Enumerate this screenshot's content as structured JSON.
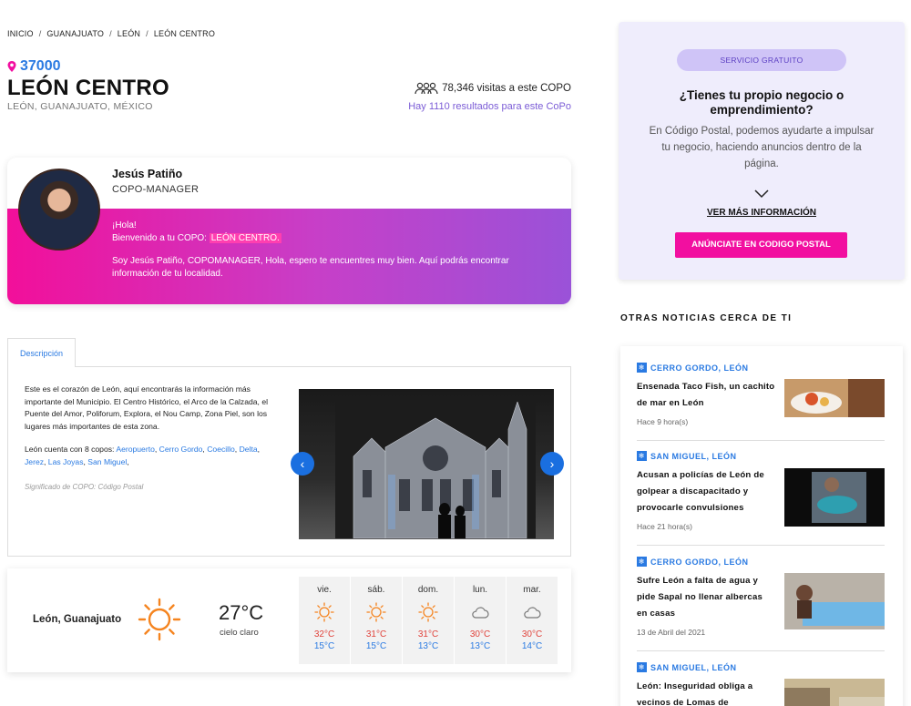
{
  "breadcrumb": {
    "items": [
      "INICIO",
      "GUANAJUATO",
      "LEÓN",
      "LEÓN CENTRO"
    ],
    "separator": "/"
  },
  "place": {
    "zip": "37000",
    "name": "LEÓN CENTRO",
    "subtitle": "LEÓN, GUANAJUATO, MÉXICO",
    "visits": "78,346 visitas a este COPO",
    "results": "Hay 1110 resultados para este CoPo"
  },
  "manager": {
    "name": "Jesús Patiño",
    "role": "COPO-MANAGER",
    "greeting": "¡Hola!",
    "welcome_prefix": "Bienvenido a tu COPO: ",
    "welcome_place": "LEÓN CENTRO.",
    "message": "Soy Jesús Patiño, COPOMANAGER, Hola, espero te encuentres muy bien. Aquí podrás encontrar información de tu localidad."
  },
  "description": {
    "tab_label": "Descripción",
    "paragraph1": "Este es el corazón de León, aquí encontrarás la información más importante del Municipio. El Centro Histórico, el Arco de la Calzada, el Puente del Amor, Poliforum, Explora, el Nou Camp, Zona Piel, son los lugares más importantes de esta zona.",
    "copos_prefix": "León cuenta con 8 copos: ",
    "copos": [
      "Aeropuerto",
      "Cerro Gordo",
      "Coecillo",
      "Delta",
      "Jerez",
      "Las Joyas",
      "San Miguel"
    ],
    "note": "Significado de COPO: Código Postal",
    "prev_arrow": "‹",
    "next_arrow": "›"
  },
  "weather": {
    "city": "León, Guanajuato",
    "current_temp": "27°C",
    "condition": "cielo claro",
    "sun_color": "#f5841f",
    "days": [
      {
        "name": "vie.",
        "icon": "sun-icon",
        "high": "32°C",
        "low": "15°C"
      },
      {
        "name": "sáb.",
        "icon": "sun-icon",
        "high": "31°C",
        "low": "15°C"
      },
      {
        "name": "dom.",
        "icon": "sun-icon",
        "high": "31°C",
        "low": "13°C"
      },
      {
        "name": "lun.",
        "icon": "cloud-icon",
        "high": "30°C",
        "low": "13°C"
      },
      {
        "name": "mar.",
        "icon": "cloud-icon",
        "high": "30°C",
        "low": "14°C"
      }
    ]
  },
  "promo": {
    "badge": "SERVICIO GRATUITO",
    "title": "¿Tienes tu propio negocio o emprendimiento?",
    "text": "En Código Postal, podemos ayudarte a impulsar tu negocio, haciendo anuncios dentro de la página.",
    "more_link": "VER MÁS INFORMACIÓN",
    "cta": "ANÚNCIATE EN CODIGO POSTAL"
  },
  "news": {
    "heading": "OTRAS NOTICIAS CERCA DE TI",
    "items": [
      {
        "tag": "CERRO GORDO, LEÓN",
        "title": "Ensenada Taco Fish, un cachito de mar en León",
        "time": "Hace 9 hora(s)"
      },
      {
        "tag": "SAN MIGUEL, LEÓN",
        "title": "Acusan a policías de León de golpear a discapacitado y provocarle convulsiones",
        "time": "Hace 21 hora(s)"
      },
      {
        "tag": "CERRO GORDO, LEÓN",
        "title": "Sufre León a falta de agua y pide Sapal no llenar albercas en casas",
        "time": "13 de Abril del 2021"
      },
      {
        "tag": "SAN MIGUEL, LEÓN",
        "title": "León: Inseguridad obliga a vecinos de Lomas de",
        "time": ""
      }
    ]
  },
  "colors": {
    "accent_blue": "#2a7ae2",
    "brand_pink": "#f20fa0",
    "purple": "#7b5cd6"
  }
}
